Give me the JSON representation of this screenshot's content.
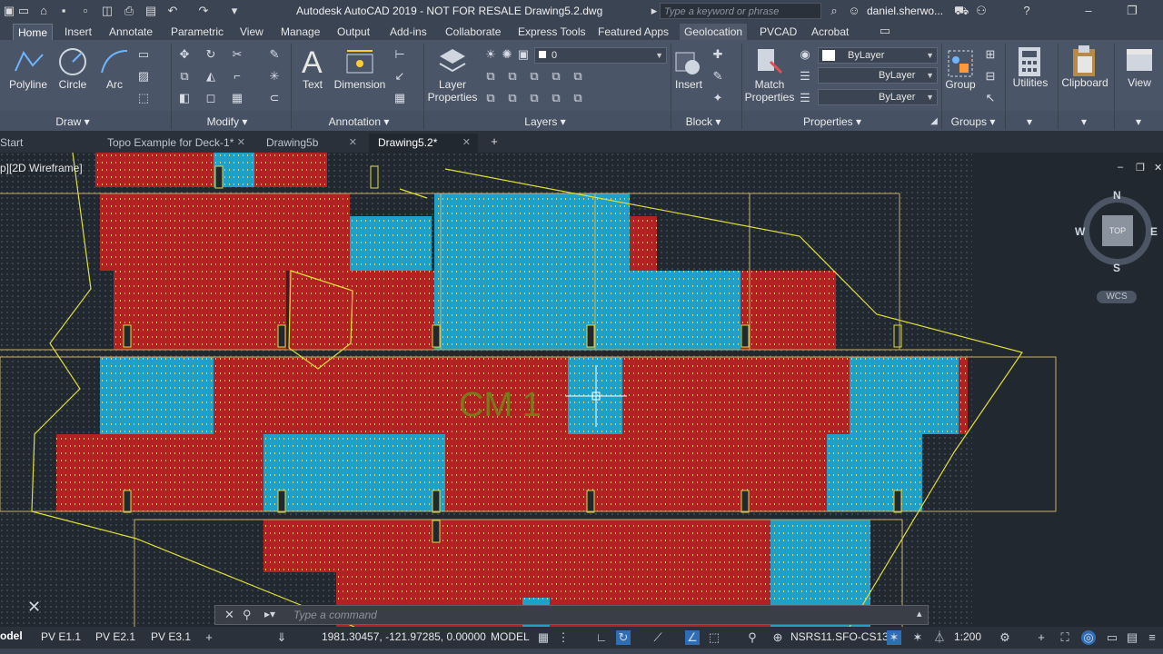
{
  "title_bar": {
    "app_title": "Autodesk AutoCAD 2019 - NOT FOR RESALE    Drawing5.2.dwg",
    "search_placeholder": "Type a keyword or phrase",
    "user_name": "daniel.sherwo..."
  },
  "ribbon_tabs": [
    "Home",
    "Insert",
    "Annotate",
    "Parametric",
    "View",
    "Manage",
    "Output",
    "Add-ins",
    "Collaborate",
    "Express Tools",
    "Featured Apps",
    "Geolocation",
    "PVCAD",
    "Acrobat"
  ],
  "ribbon": {
    "draw": {
      "polyline": "Polyline",
      "circle": "Circle",
      "arc": "Arc",
      "panel": "Draw"
    },
    "modify": {
      "panel": "Modify"
    },
    "annotation": {
      "text": "Text",
      "dimension": "Dimension",
      "panel": "Annotation"
    },
    "layers": {
      "layer_properties": "Layer\nProperties",
      "current_layer": "0",
      "panel": "Layers"
    },
    "block": {
      "insert": "Insert",
      "panel": "Block"
    },
    "properties": {
      "match_properties": "Match\nProperties",
      "color": "ByLayer",
      "linetype": "ByLayer",
      "lineweight": "ByLayer",
      "panel": "Properties"
    },
    "groups": {
      "group": "Group",
      "panel": "Groups"
    },
    "utilities": {
      "label": "Utilities"
    },
    "clipboard": {
      "label": "Clipboard"
    },
    "view": {
      "label": "View"
    }
  },
  "file_tabs": [
    {
      "label": "Start"
    },
    {
      "label": "Topo Example for Deck-1*"
    },
    {
      "label": "Drawing5b"
    },
    {
      "label": "Drawing5.2*"
    }
  ],
  "viewport": {
    "view_label": "p][2D Wireframe]",
    "block_label": "CM 1",
    "viewcube": {
      "top": "TOP",
      "n": "N",
      "s": "S",
      "e": "E",
      "w": "W",
      "wcs": "WCS"
    }
  },
  "command_line": {
    "placeholder": "Type a command"
  },
  "layout_tabs": [
    "odel",
    "PV E1.1",
    "PV E2.1",
    "PV E3.1"
  ],
  "status_bar": {
    "coordinates": "1981.30457, -121.97285, 0.00000",
    "space": "MODEL",
    "coord_system": "NSRS11.SFO-CS13",
    "scale": "1:200"
  },
  "colors": {
    "background": "#212830",
    "red_module": "#b22222",
    "blue_module": "#1fa0c8",
    "boundary_yellow": "#dede3a",
    "frame_tan": "#c8b06a"
  }
}
